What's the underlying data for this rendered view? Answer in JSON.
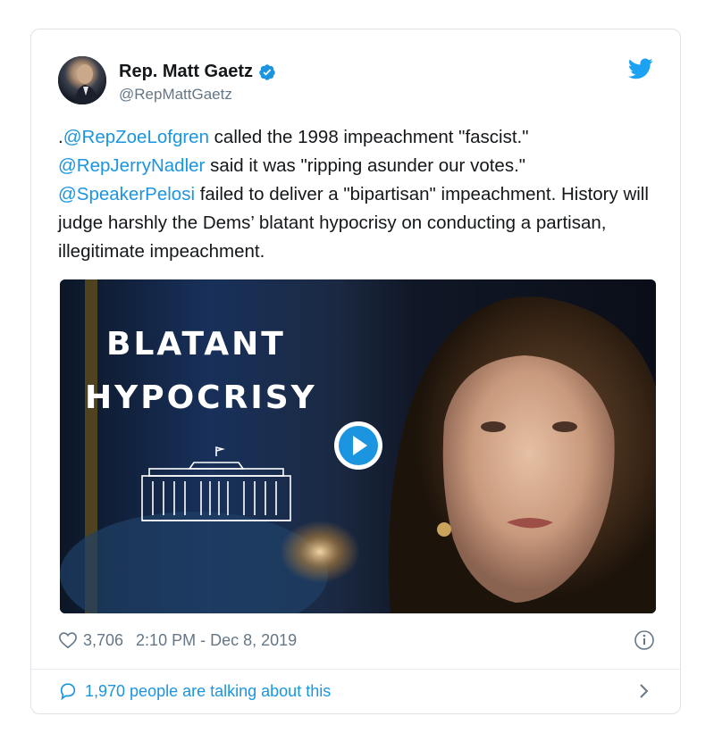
{
  "author": {
    "display_name": "Rep. Matt Gaetz",
    "handle": "@RepMattGaetz",
    "verified": true
  },
  "tweet": {
    "segments": [
      {
        "text": ".",
        "type": "text"
      },
      {
        "text": "@RepZoeLofgren",
        "type": "mention"
      },
      {
        "text": " called the 1998 impeachment \"fascist.\" ",
        "type": "text"
      },
      {
        "text": "@RepJerryNadler",
        "type": "mention"
      },
      {
        "text": " said it was \"ripping asunder our votes.\" ",
        "type": "text"
      },
      {
        "text": "@SpeakerPelosi",
        "type": "mention"
      },
      {
        "text": " failed to deliver a \"bipartisan\" impeachment. History will judge harshly the Dems’ blatant hypocrisy on conducting a partisan, illegitimate impeachment.",
        "type": "text"
      }
    ]
  },
  "media": {
    "type": "video",
    "overlay_line1": "BLATANT",
    "overlay_line2": "HYPOCRISY",
    "logo_icon": "white-house-icon",
    "play_icon": "play-icon"
  },
  "meta": {
    "likes": "3,706",
    "timestamp": "2:10 PM - Dec 8, 2019",
    "like_icon": "heart-icon",
    "info_icon": "info-icon"
  },
  "footer": {
    "talking_label": "1,970 people are talking about this",
    "icon": "reply-bubble-icon"
  },
  "colors": {
    "link": "#1b95e0",
    "text": "#14171a",
    "muted": "#657786",
    "border": "#dfe3e8"
  }
}
